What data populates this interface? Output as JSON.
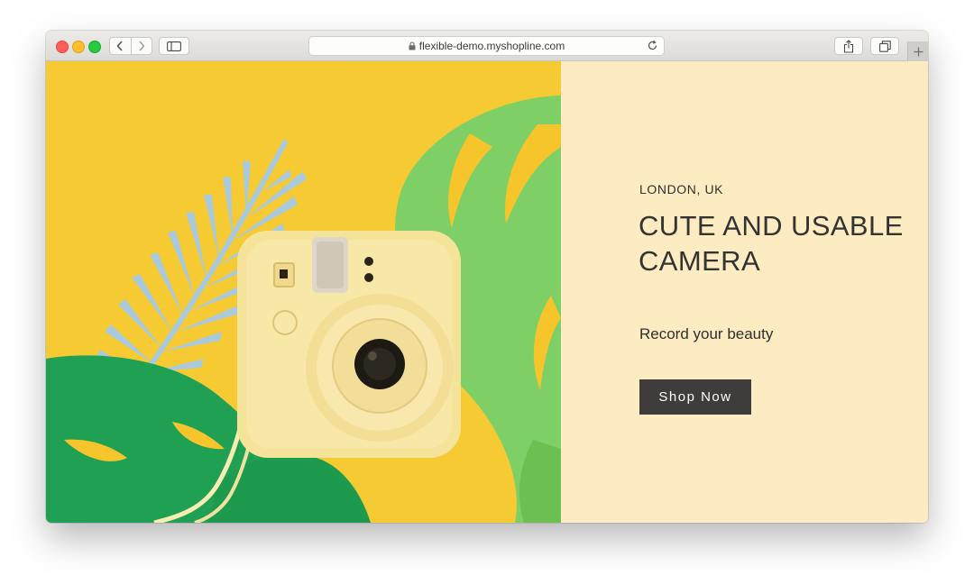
{
  "browser": {
    "url": "flexible-demo.myshopline.com",
    "icons": {
      "close": "red-traffic-light",
      "minimize": "yellow-traffic-light",
      "zoom": "green-traffic-light",
      "back": "chevron-left-icon",
      "forward": "chevron-right-icon",
      "sidebar": "sidebar-icon",
      "lock": "lock-icon",
      "reload": "reload-icon",
      "share": "share-icon",
      "tabs": "tab-overview-icon",
      "new_tab": "plus-icon"
    }
  },
  "hero": {
    "location": "LONDON, UK",
    "headline": "CUTE AND USABLE CAMERA",
    "subheading": "Record your beauty",
    "cta_label": "Shop Now"
  },
  "colors": {
    "background_yellow": "#f5c52b",
    "panel_cream": "#fdebc1",
    "button_dark": "#3f3d3c",
    "text_dark": "#333333"
  }
}
